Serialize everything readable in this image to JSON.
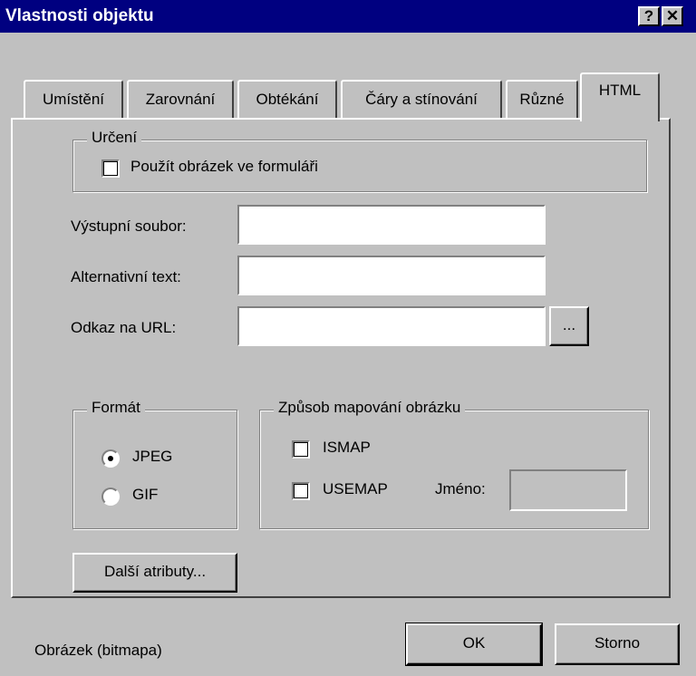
{
  "window": {
    "title": "Vlastnosti objektu",
    "help_button": "?",
    "close_button": "✕"
  },
  "tabs": [
    {
      "label": "Umístění",
      "active": false
    },
    {
      "label": "Zarovnání",
      "active": false
    },
    {
      "label": "Obtékání",
      "active": false
    },
    {
      "label": "Čáry a stínování",
      "active": false
    },
    {
      "label": "Různé",
      "active": false
    },
    {
      "label": "HTML",
      "active": true
    }
  ],
  "urceni": {
    "group_label": "Určení",
    "checkbox": {
      "label": "Použít obrázek ve formuláři",
      "checked": false
    }
  },
  "fields": {
    "output_file": {
      "label": "Výstupní soubor:",
      "value": ""
    },
    "alt_text": {
      "label": "Alternativní text:",
      "value": ""
    },
    "url": {
      "label": "Odkaz na URL:",
      "value": "",
      "browse_label": "..."
    }
  },
  "format": {
    "group_label": "Formát",
    "options": [
      {
        "label": "JPEG",
        "selected": true
      },
      {
        "label": "GIF",
        "selected": false
      }
    ]
  },
  "mapping": {
    "group_label": "Způsob mapování obrázku",
    "ismap": {
      "label": "ISMAP",
      "checked": false
    },
    "usemap": {
      "label": "USEMAP",
      "checked": false
    },
    "name_label": "Jméno:",
    "name_value": ""
  },
  "more_attributes_button": "Další atributy...",
  "status_text": "Obrázek (bitmapa)",
  "ok_button": "OK",
  "cancel_button": "Storno"
}
